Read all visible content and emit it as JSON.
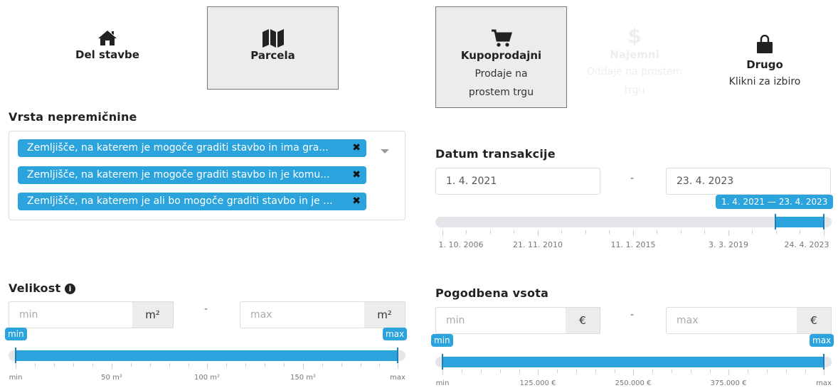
{
  "property_types": [
    {
      "title": "Del stavbe",
      "icon": "home-icon",
      "selected": false
    },
    {
      "title": "Parcela",
      "icon": "map-icon",
      "selected": true
    }
  ],
  "transaction_types": [
    {
      "title": "Kupoprodajni",
      "subtitle_line1": "Prodaje na",
      "subtitle_line2": "prostem trgu",
      "icon": "cart-icon",
      "selected": true
    },
    {
      "title": "Najemni",
      "subtitle_line1": "Oddaje na prostem",
      "subtitle_line2": "trgu",
      "icon": "dollar-icon",
      "selected": false,
      "disabled": true
    },
    {
      "title": "Drugo",
      "subtitle_line1": "Klikni za izbiro",
      "icon": "bag-icon",
      "selected": false
    }
  ],
  "vrsta": {
    "label": "Vrsta nepremičnine",
    "chips": [
      "Zemljišče, na katerem je mogoče graditi stavbo in ima gra...",
      "Zemljišče, na katerem je mogoče graditi stavbo in je komu...",
      "Zemljišče, na katerem je ali bo mogoče graditi stavbo in je ..."
    ],
    "remove_symbol": "✖"
  },
  "datum": {
    "label": "Datum transakcije",
    "from": "1. 4. 2021",
    "to": "23. 4. 2023",
    "range_tag": "1. 4. 2021 — 23. 4. 2023",
    "dash": "-",
    "scale_labels": [
      "1. 10. 2006",
      "21. 11. 2010",
      "11. 1. 2015",
      "3. 3. 2019",
      "24. 4. 2023"
    ],
    "selected_fraction": [
      0.861,
      1.0
    ]
  },
  "velikost": {
    "label": "Velikost",
    "info_icon": "info-icon",
    "min_placeholder": "min",
    "max_placeholder": "max",
    "unit": "m²",
    "dash": "-",
    "min_tag": "min",
    "max_tag": "max",
    "scale_labels": [
      "min",
      "50 m²",
      "100 m²",
      "150 m²",
      "max"
    ],
    "selected_fraction": [
      0.0,
      1.0
    ]
  },
  "vsota": {
    "label": "Pogodbena vsota",
    "min_placeholder": "min",
    "max_placeholder": "max",
    "unit": "€",
    "dash": "-",
    "min_tag": "min",
    "max_tag": "max",
    "scale_labels": [
      "min",
      "125.000 €",
      "250.000 €",
      "375.000 €",
      "max"
    ],
    "selected_fraction": [
      0.0,
      1.0
    ]
  },
  "colors": {
    "accent": "#2ba3dd",
    "track": "#e3e5e8",
    "selected_tile_bg": "#ececec"
  }
}
